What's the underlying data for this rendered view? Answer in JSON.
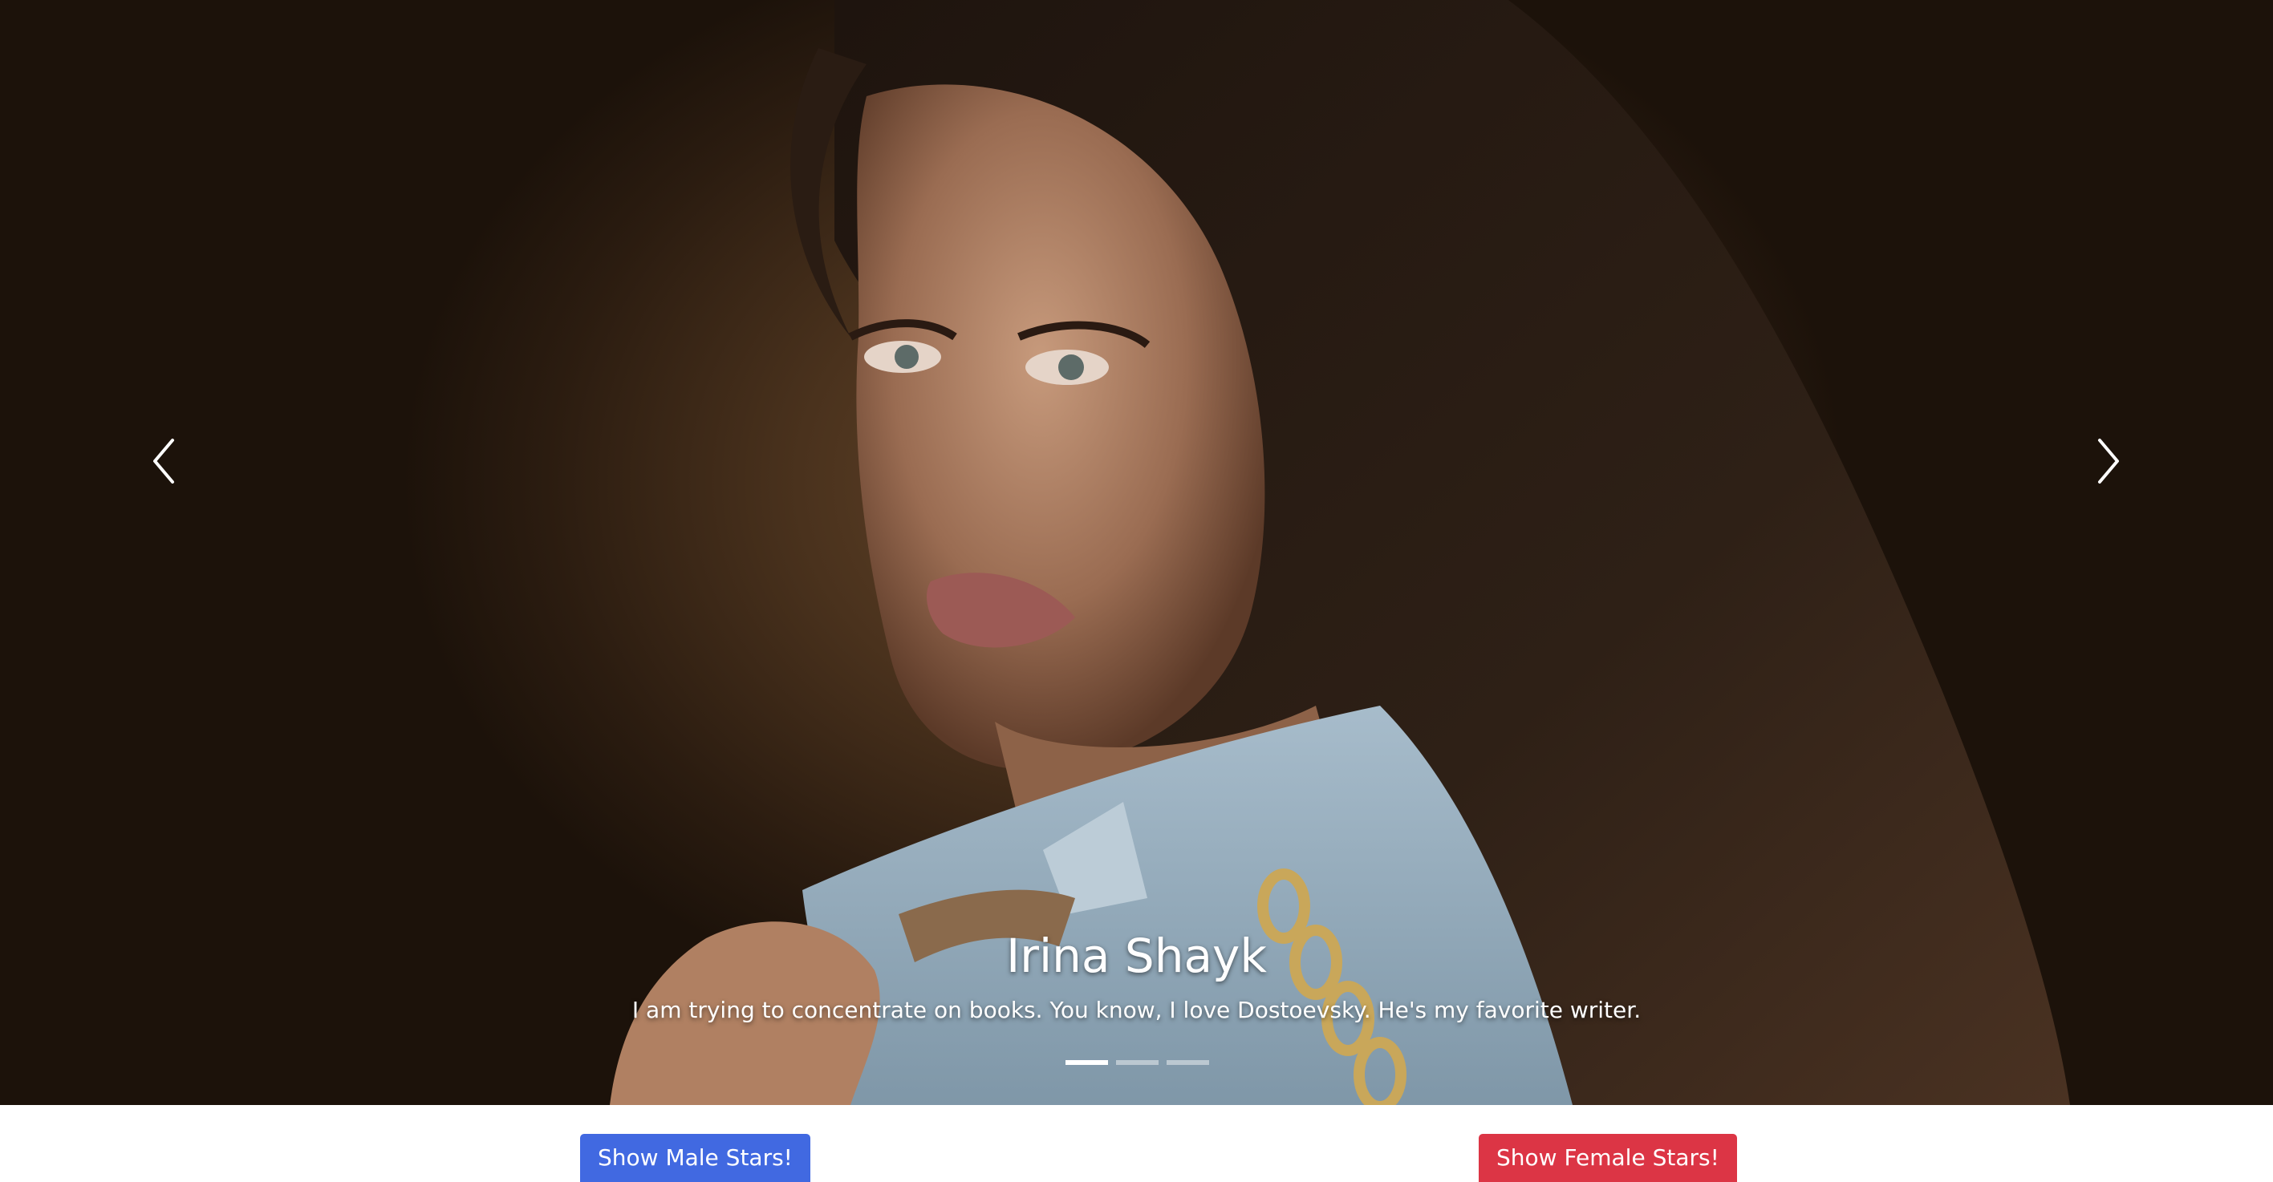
{
  "carousel": {
    "caption_title": "Irina Shayk",
    "caption_text": "I am trying to concentrate on books. You know, I love Dostoevsky. He's my favorite writer.",
    "slide_count": 3,
    "active_slide": 1,
    "prev_icon": "chevron-left-icon",
    "next_icon": "chevron-right-icon"
  },
  "buttons": {
    "male_label": "Show Male Stars!",
    "female_label": "Show Female Stars!"
  },
  "colors": {
    "male_button": "#4169e1",
    "female_button": "#dc3545"
  }
}
